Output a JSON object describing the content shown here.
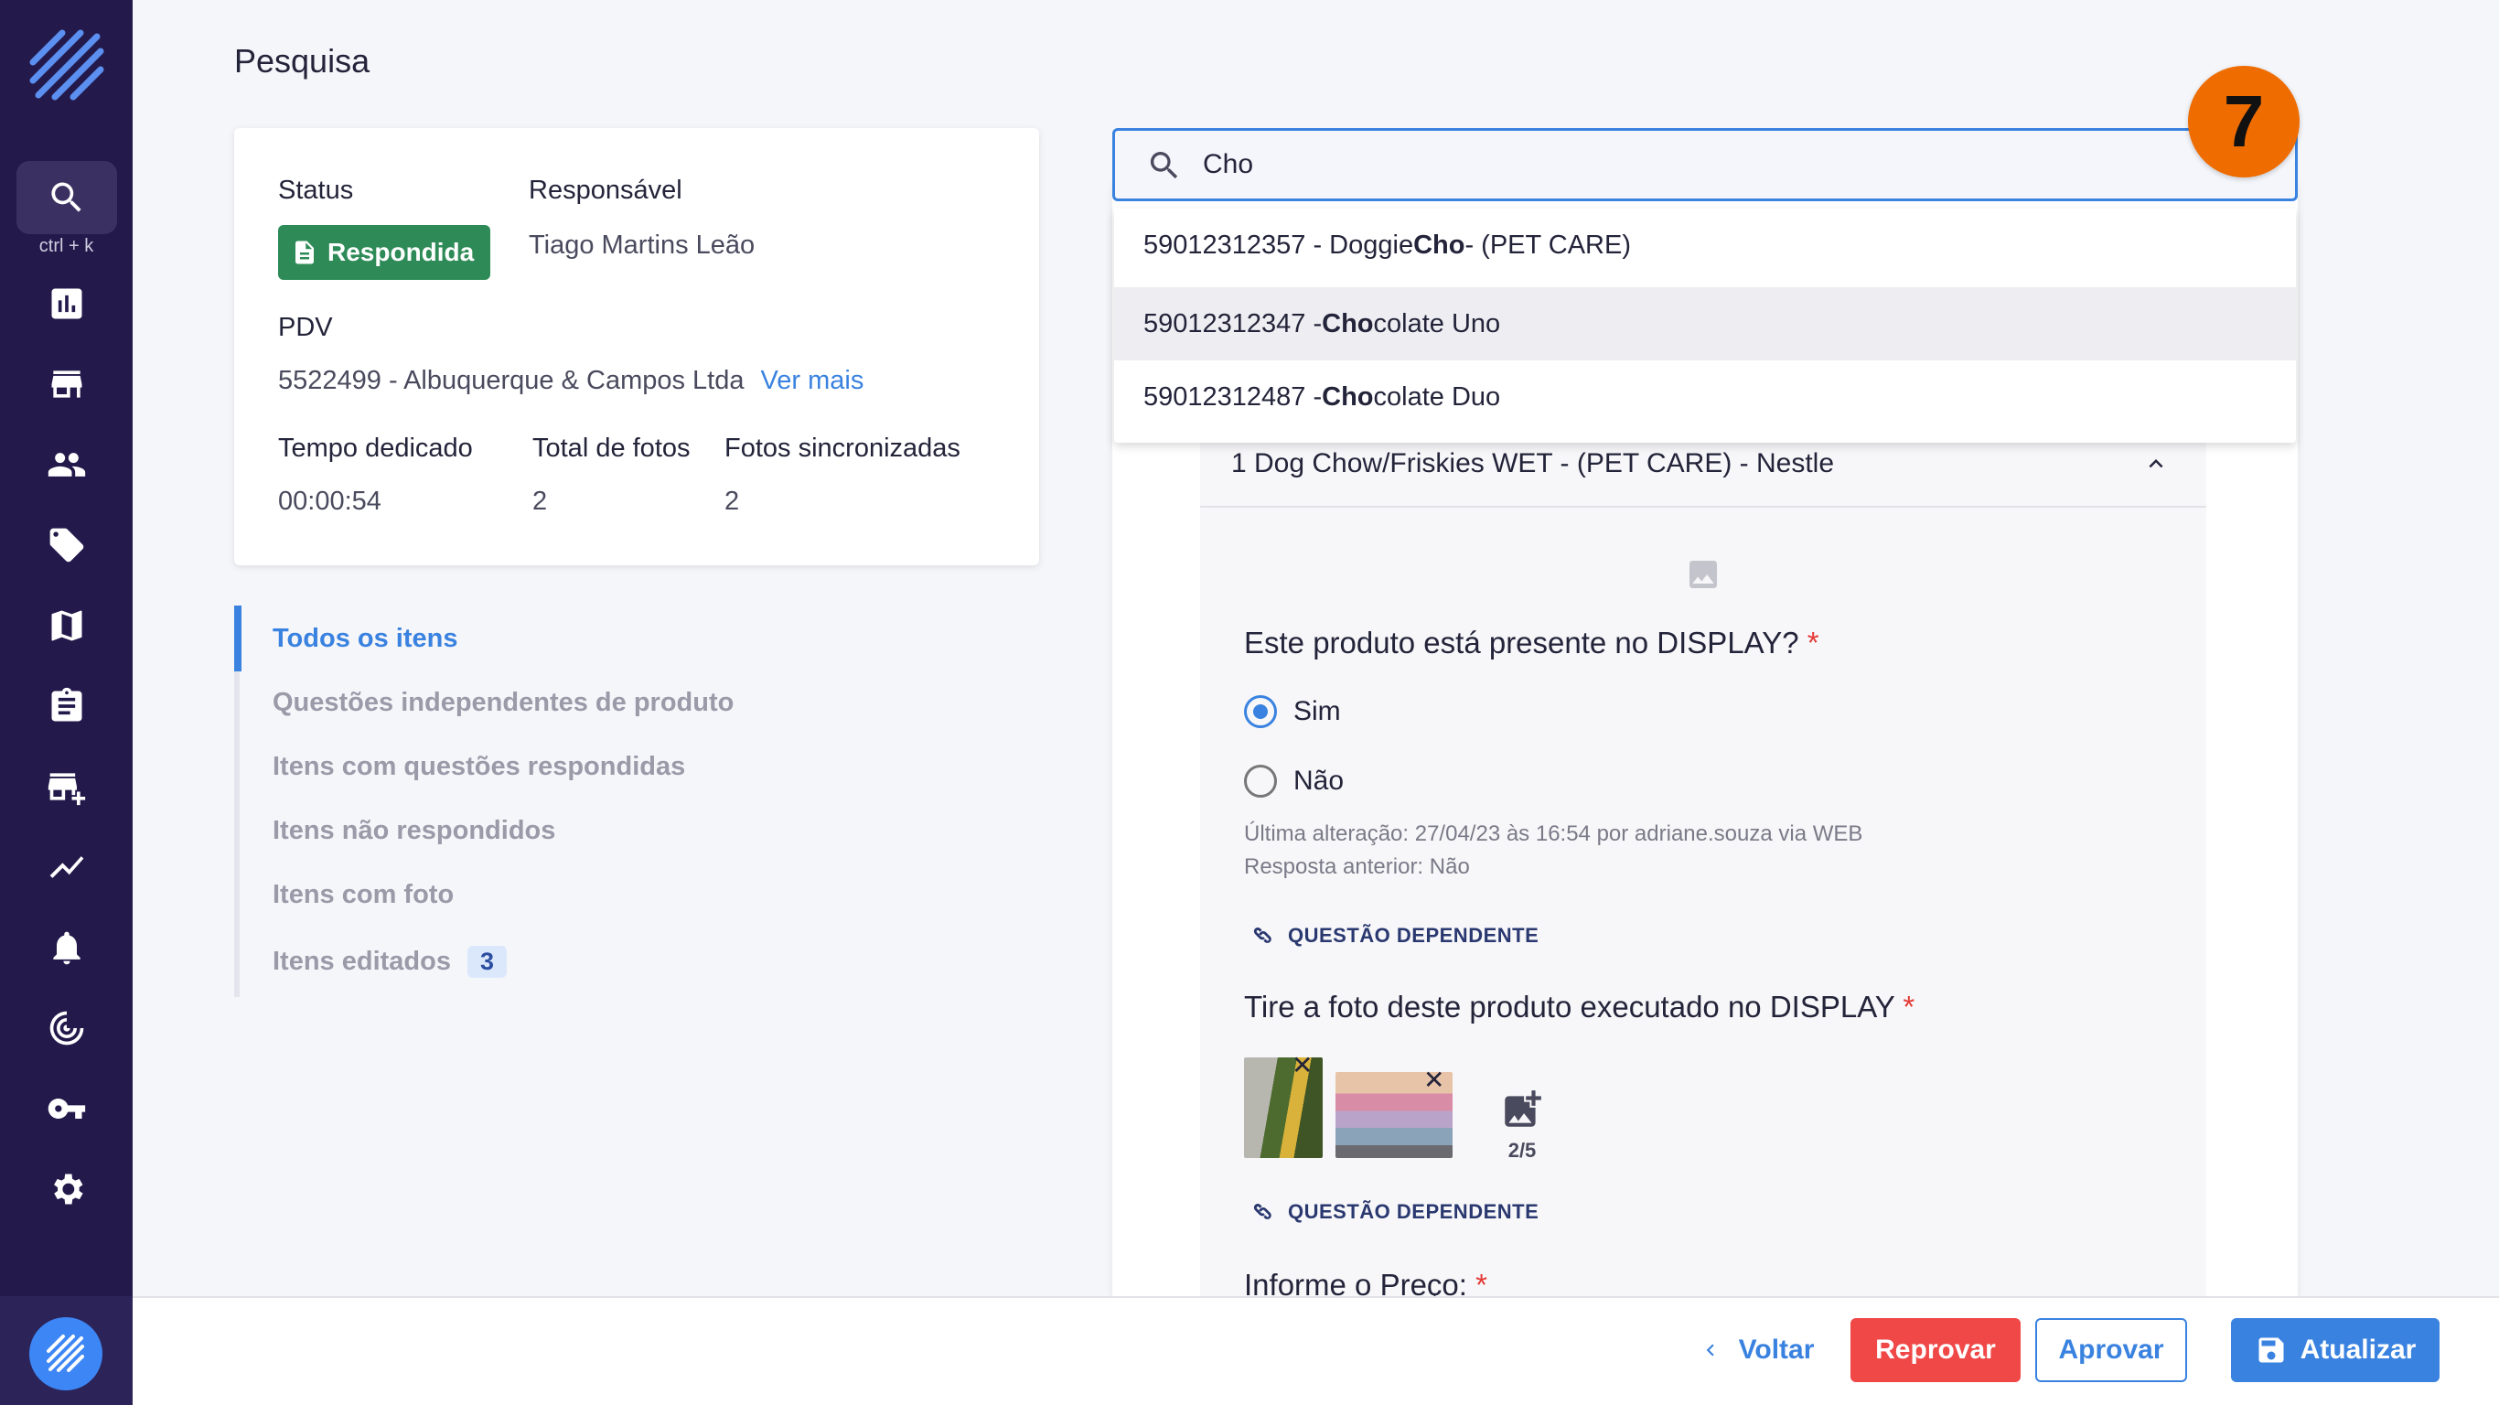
{
  "sidebar": {
    "shortcut": "ctrl + k",
    "items": [
      "search-icon",
      "chart-icon",
      "store-icon",
      "people-icon",
      "tag-icon",
      "map-icon",
      "clipboard-icon",
      "add-business-icon",
      "trending-icon",
      "bell-icon",
      "radar-icon",
      "key-icon",
      "gear-icon"
    ]
  },
  "page": {
    "title": "Pesquisa"
  },
  "info": {
    "status_label": "Status",
    "status_value": "Respondida",
    "responsavel_label": "Responsável",
    "responsavel_value": "Tiago Martins Leão",
    "pdv_label": "PDV",
    "pdv_value": "5522499 - Albuquerque & Campos Ltda",
    "ver_mais": "Ver mais",
    "tempo_label": "Tempo dedicado",
    "tempo_value": "00:00:54",
    "fotos_label": "Total de fotos",
    "fotos_value": "2",
    "sync_label": "Fotos sincronizadas",
    "sync_value": "2"
  },
  "filters": {
    "items": [
      "Todos os itens",
      "Questões independentes de produto",
      "Itens com questões respondidas",
      "Itens não respondidos",
      "Itens com foto",
      "Itens editados"
    ],
    "edited_count": "3"
  },
  "search": {
    "value": "Cho",
    "step": "7",
    "results": [
      {
        "code": "59012312357 - Doggie ",
        "match": "Cho",
        "rest": " - (PET CARE)"
      },
      {
        "code": "59012312347 - ",
        "match": "Cho",
        "rest": "colate Uno"
      },
      {
        "code": "59012312487 - ",
        "match": "Cho",
        "rest": "colate Duo"
      }
    ]
  },
  "product": {
    "title": "1 Dog Chow/Friskies WET - (PET CARE) - Nestle",
    "q1": "Este produto está presente no DISPLAY?",
    "opt_yes": "Sim",
    "opt_no": "Não",
    "meta1": "Última alteração: 27/04/23 às 16:54 por adriane.souza via WEB",
    "meta2": "Resposta anterior:  Não",
    "dep": "QUESTÃO DEPENDENTE",
    "q2": "Tire a foto deste produto executado no DISPLAY",
    "photo_count": "2/5",
    "q3": "Informe o Preço:",
    "required_mark": "*",
    "close_mark": "✕"
  },
  "footer": {
    "back": "Voltar",
    "reprovar": "Reprovar",
    "aprovar": "Aprovar",
    "atualizar": "Atualizar"
  },
  "colors": {
    "sidebar": "#231a4b",
    "accent": "#3a82e0",
    "success": "#2e8b57",
    "danger": "#f04747",
    "step_badge": "#ef6c00"
  }
}
